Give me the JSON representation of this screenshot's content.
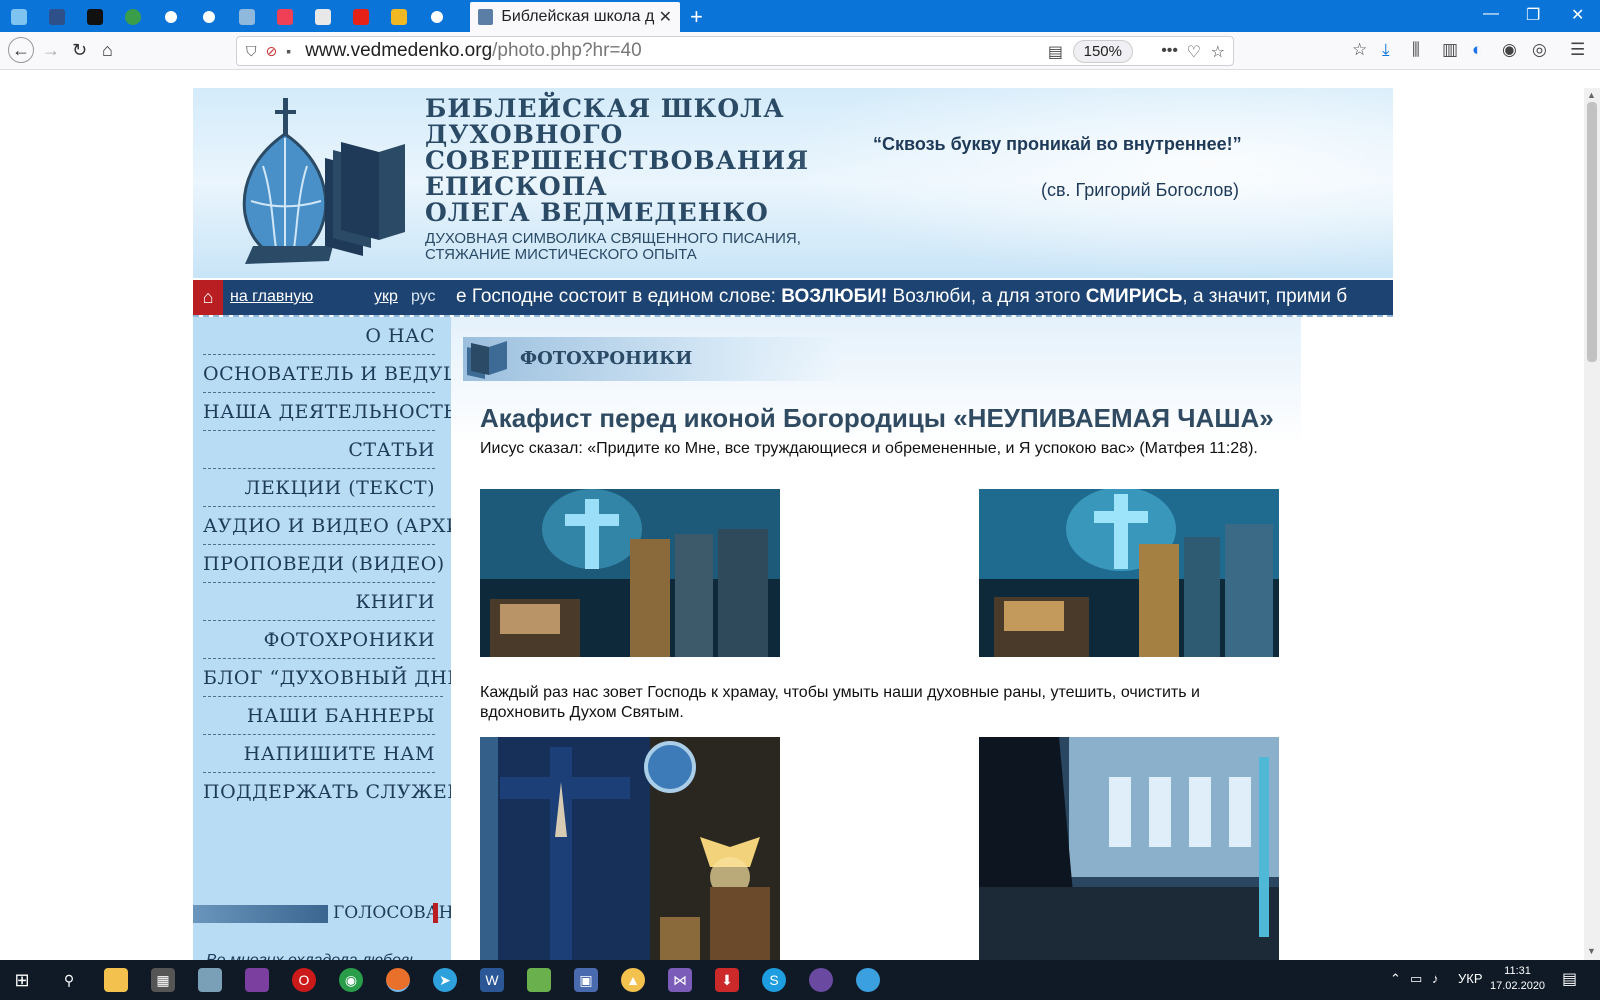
{
  "browser": {
    "active_tab_title": "Библейская школа д",
    "close_tab": "✕",
    "new_tab": "+",
    "url_domain": "www.vedmedenko.org",
    "url_path": "/photo.php?hr=40",
    "zoom": "150%",
    "window_controls": {
      "minimize": "—",
      "restore": "❐",
      "close": "✕"
    },
    "nav": {
      "back": "←",
      "forward": "→",
      "reload": "↻",
      "home": "⌂"
    },
    "toolbar_icons": [
      "bookmarks-icon",
      "downloads-icon",
      "library-icon",
      "sidebar-icon",
      "account-icon",
      "menu-icon"
    ],
    "pinned_tab_icons": [
      "app-icon-1",
      "app-icon-2",
      "app-icon-3",
      "app-icon-4",
      "globe-icon",
      "globe-icon",
      "app-icon-5",
      "pocket-icon",
      "app-icon-6",
      "youtube-icon",
      "app-icon-7",
      "globe-icon"
    ]
  },
  "header": {
    "title_lines": [
      "БИБЛЕЙСКАЯ ШКОЛА",
      "ДУХОВНОГО",
      "СОВЕРШЕНСТВОВАНИЯ",
      "ЕПИСКОПА",
      "ОЛЕГА ВЕДМЕДЕНКО"
    ],
    "subtitle_lines": [
      "ДУХОВНАЯ СИМВОЛИКА СВЯЩЕННОГО ПИСАНИЯ,",
      "СТЯЖАНИЕ МИСТИЧЕСКОГО ОПЫТА"
    ],
    "quote": "“Сквозь букву проникай во внутреннее!”",
    "quote_source": "(св. Григорий Богослов)"
  },
  "nav_strip": {
    "home_link": "на главную",
    "lang_ukr": "укр",
    "lang_rus": "рус",
    "ticker_a": "е Господне состоит в едином слове: ",
    "ticker_b": "ВОЗЛЮБИ!",
    "ticker_c": " Возлюби, а для этого ",
    "ticker_d": "СМИРИСЬ",
    "ticker_e": ", а значит, прими б"
  },
  "sidebar": {
    "menu": [
      "О НАС",
      "ОСНОВАТЕЛЬ И ВЕДУЩИЙ",
      "НАША ДЕЯТЕЛЬНОСТЬ",
      "СТАТЬИ",
      "ЛЕКЦИИ (ТЕКСТ)",
      "АУДИО И ВИДЕО (АРХИВ)",
      "ПРОПОВЕДИ (ВИДЕО)",
      "КНИГИ",
      "ФОТОХРОНИКИ",
      "БЛОГ “ДУХОВНЫЙ ДНЕВНИК”",
      "НАШИ БАННЕРЫ",
      "НАПИШИТЕ НАМ",
      "ПОДДЕРЖАТЬ СЛУЖЕНИЕ"
    ],
    "vote_label": "ГОЛОСОВАНИЕ",
    "side_quote": "Во многих охладела любовь."
  },
  "content": {
    "section_title": "ФОТОХРОНИКИ",
    "heading": "Акафист перед иконой Богородицы «НЕУПИВАЕМАЯ ЧАША»",
    "para1": "Иисус сказал: «Придите ко Мне, все труждающиеся и обремененные, и Я успокою вас» (Матфея 11:28).",
    "para2": "Каждый раз нас зовет Господь к храмау, чтобы умыть наши духовные раны, утешить, очистить и вдохновить Духом Святым."
  },
  "taskbar": {
    "lang": "УКР",
    "time": "11:31",
    "date": "17.02.2020",
    "apps": [
      "start-icon",
      "search-icon",
      "explorer-icon",
      "calculator-icon",
      "app-icon",
      "app-icon",
      "opera-icon",
      "chrome-icon",
      "firefox-icon",
      "telegram-icon",
      "word-icon",
      "notepad-icon",
      "save-icon",
      "app-icon",
      "vs-icon",
      "download-icon",
      "skype-icon",
      "app-icon",
      "app-icon"
    ]
  }
}
